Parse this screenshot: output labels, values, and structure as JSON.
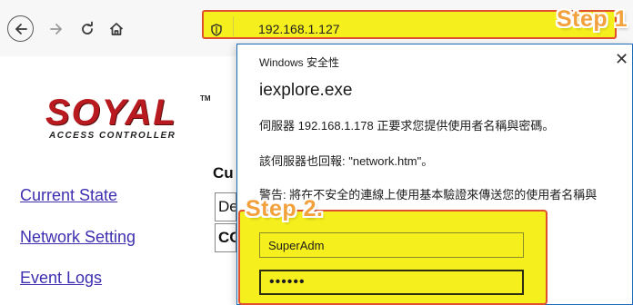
{
  "browser": {
    "url": "192.168.1.127",
    "annotation_step1": "Step 1"
  },
  "page": {
    "logo_text": "SOYAL",
    "logo_tm": "TM",
    "logo_subtitle": "ACCESS CONTROLLER",
    "nav_links": [
      "Current State",
      "Network Setting",
      "Event Logs"
    ],
    "heading_partial": "Cu",
    "table_cells": [
      "De",
      "CC"
    ]
  },
  "dialog": {
    "title": "Windows 安全性",
    "app_name": "iexplore.exe",
    "message_1": "伺服器 192.168.1.178 正要求您提供使用者名稱與密碼。",
    "message_2": "該伺服器也回報: \"network.htm\"。",
    "message_3": "警告: 將在不安全的連線上使用基本驗證來傳送您的使用者名稱與",
    "username_value": "SuperAdm",
    "password_value": "••••••",
    "annotation_step2": "Step 2."
  },
  "colors": {
    "highlight_yellow": "#f6ef1e",
    "highlight_border": "#e0502d",
    "step_orange": "#f2a13c",
    "logo_red": "#b91a1f",
    "link_blue": "#3d2fb0"
  }
}
